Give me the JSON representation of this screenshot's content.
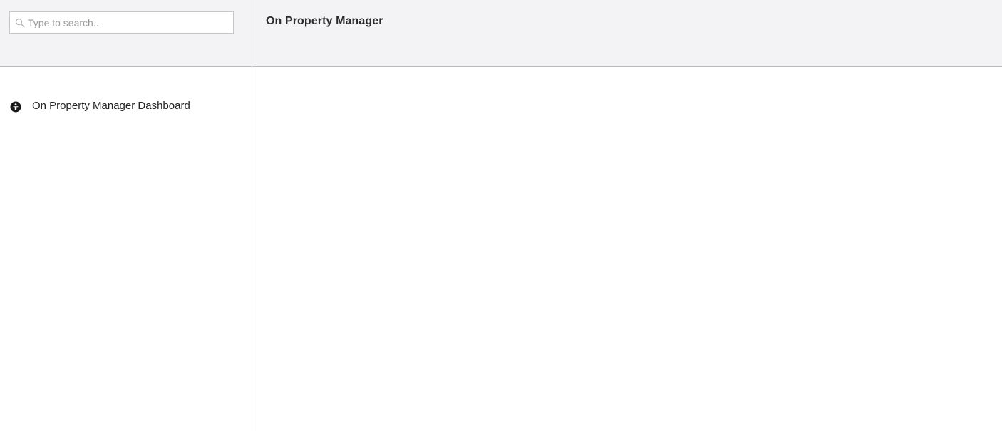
{
  "search": {
    "placeholder": "Type to search...",
    "value": "",
    "icon": "search-icon"
  },
  "sidebar": {
    "items": [
      {
        "label": "On Property Manager Dashboard",
        "icon": "info-person-icon"
      }
    ]
  },
  "header": {
    "title": "On Property Manager"
  },
  "colors": {
    "header_bg": "#f3f3f5",
    "border": "#b9b9bc",
    "text": "#222222",
    "placeholder": "#9a9a9d"
  }
}
